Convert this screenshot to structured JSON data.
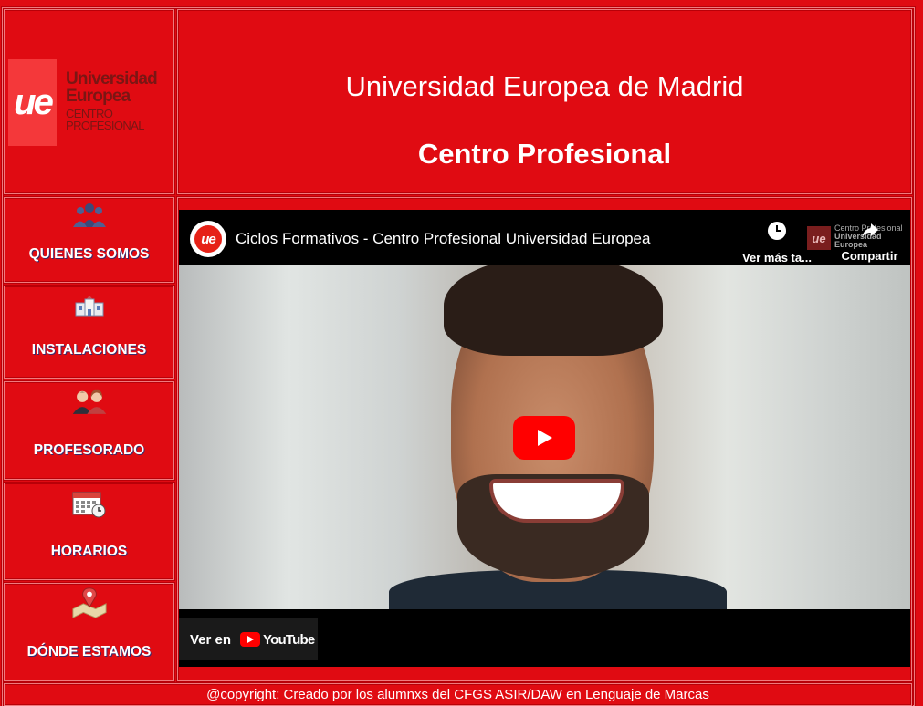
{
  "logo": {
    "mark": "ue",
    "line1": "Universidad",
    "line2": "Europea",
    "line3": "CENTRO PROFESIONAL"
  },
  "header": {
    "title": "Universidad Europea de Madrid",
    "subtitle": "Centro Profesional"
  },
  "nav": [
    {
      "label": "QUIENES SOMOS",
      "icon": "group-people-icon"
    },
    {
      "label": "INSTALACIONES",
      "icon": "building-icon"
    },
    {
      "label": "PROFESORADO",
      "icon": "teachers-icon"
    },
    {
      "label": "HORARIOS",
      "icon": "calendar-clock-icon"
    },
    {
      "label": "DÓNDE ESTAMOS",
      "icon": "map-pin-icon"
    }
  ],
  "video": {
    "channel_mark": "ue",
    "title": "Ciclos Formativos - Centro Profesional Universidad Europea",
    "watch_later_label": "Ver más ta...",
    "share_label": "Compartir",
    "watermark": {
      "line1": "Centro Profesional",
      "line2": "Universidad",
      "line3": "Europea"
    },
    "watch_on_label": "Ver en",
    "youtube_label": "YouTube"
  },
  "footer": {
    "text": "@copyright: Creado por los alumnxs del CFGS ASIR/DAW en Lenguaje de Marcas"
  }
}
